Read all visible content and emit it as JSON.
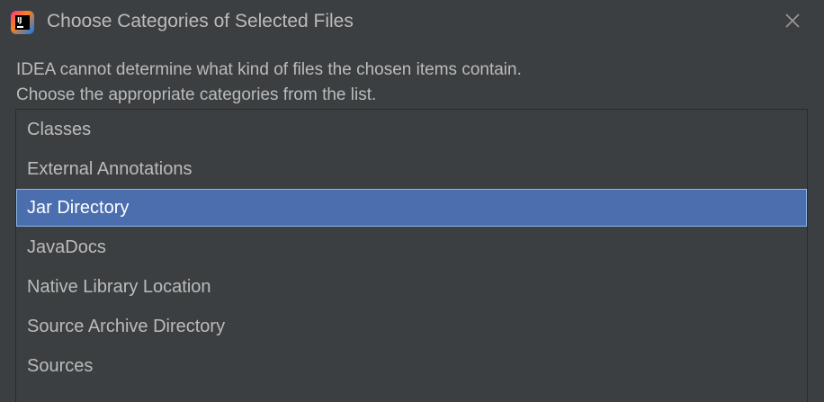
{
  "window": {
    "title": "Choose Categories of Selected Files",
    "app_icon": "intellij-idea-icon",
    "app_icon_text": "IJ",
    "close_icon": "close-icon"
  },
  "message": {
    "line1": "IDEA cannot determine what kind of files the chosen items contain.",
    "line2": "Choose the appropriate categories from the list."
  },
  "categories": {
    "items": [
      {
        "label": "Classes",
        "selected": false
      },
      {
        "label": "External Annotations",
        "selected": false
      },
      {
        "label": "Jar Directory",
        "selected": true
      },
      {
        "label": "JavaDocs",
        "selected": false
      },
      {
        "label": "Native Library Location",
        "selected": false
      },
      {
        "label": "Source Archive Directory",
        "selected": false
      },
      {
        "label": "Sources",
        "selected": false
      }
    ]
  },
  "colors": {
    "background": "#3c3f41",
    "text": "#bbbbbb",
    "selection": "#4b6eaf",
    "selection_border": "#8bb8e8"
  }
}
